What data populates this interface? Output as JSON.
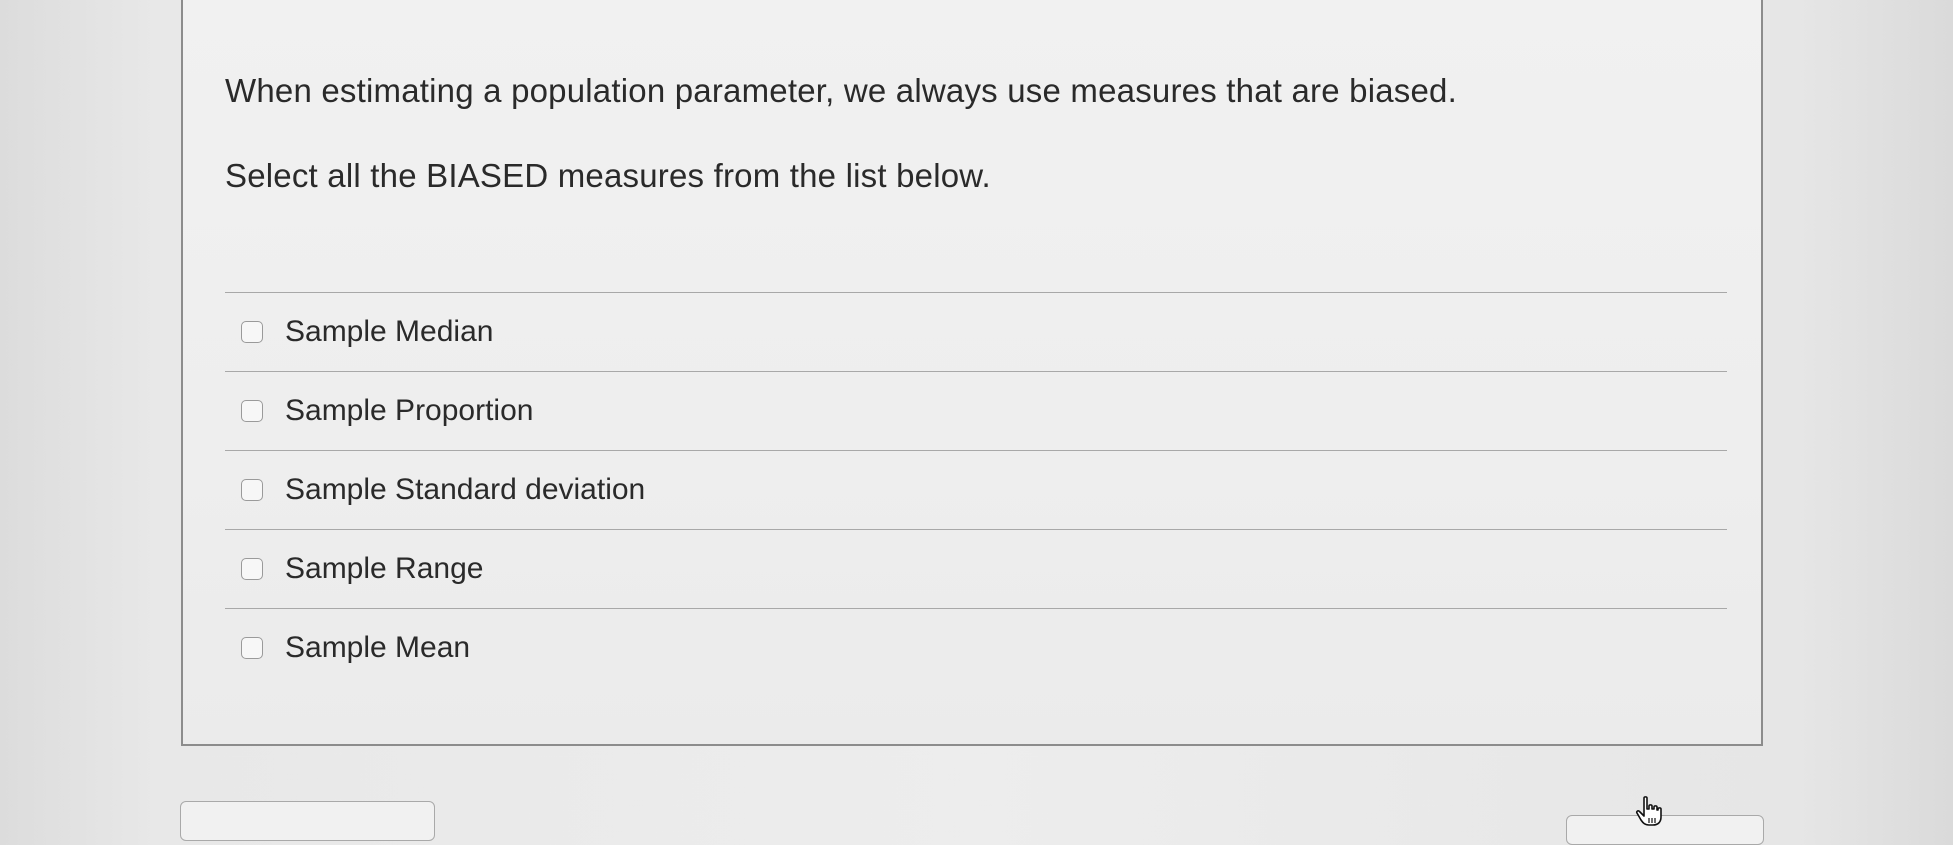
{
  "question": {
    "line1": "When estimating a population parameter, we always use measures that are biased.",
    "line2": "Select all the BIASED measures from the list below."
  },
  "options": [
    {
      "label": "Sample Median",
      "checked": false
    },
    {
      "label": "Sample Proportion",
      "checked": false
    },
    {
      "label": "Sample Standard deviation",
      "checked": false
    },
    {
      "label": "Sample Range",
      "checked": false
    },
    {
      "label": "Sample Mean",
      "checked": false
    }
  ],
  "cursor": {
    "icon": "hand-pointer-icon"
  }
}
